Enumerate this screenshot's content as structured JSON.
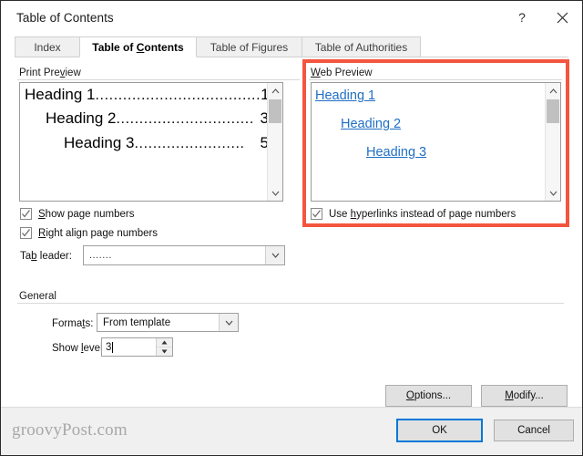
{
  "window": {
    "title": "Table of Contents",
    "help_button": "?",
    "close_button": "×"
  },
  "tabs": [
    {
      "label": "Index",
      "accel": "",
      "selected": false
    },
    {
      "label": "Table of Contents",
      "accel": "C",
      "selected": true
    },
    {
      "label": "Table of Figures",
      "accel": "",
      "selected": false
    },
    {
      "label": "Table of Authorities",
      "accel": "",
      "selected": false
    }
  ],
  "print_preview": {
    "group_label_pre": "Print Pre",
    "group_label_accel": "v",
    "group_label_post": "iew",
    "entries": [
      {
        "text": "Heading 1",
        "leader": "....................................",
        "page": "1",
        "indent": 0
      },
      {
        "text": "Heading 2",
        "leader": "..............................",
        "page": "3",
        "indent": 1
      },
      {
        "text": "Heading 3 ",
        "leader": "........................",
        "page": "5",
        "indent": 2
      }
    ],
    "checkboxes": [
      {
        "pre": "",
        "accel": "S",
        "post": "how page numbers",
        "checked": true
      },
      {
        "pre": "",
        "accel": "R",
        "post": "ight align page numbers",
        "checked": true
      }
    ],
    "tab_leader": {
      "label_pre": "Ta",
      "label_accel": "b",
      "label_post": " leader:",
      "value": ".......",
      "arrow": "⌄"
    }
  },
  "web_preview": {
    "group_label_accel": "W",
    "group_label_post": "eb Preview",
    "entries": [
      {
        "text": "Heading 1",
        "indent": 0
      },
      {
        "text": "Heading 2",
        "indent": 1
      },
      {
        "text": "Heading 3",
        "indent": 2
      }
    ],
    "checkbox": {
      "pre": "Use ",
      "accel": "h",
      "post": "yperlinks instead of page numbers",
      "checked": true
    },
    "link_color": "#1f6fc5",
    "highlight_color": "#f4553f"
  },
  "general": {
    "group_label": "General",
    "formats": {
      "label_pre": "Forma",
      "label_accel": "t",
      "label_post": "s:",
      "value": "From template",
      "arrow": "⌄"
    },
    "show_levels": {
      "label_pre": "Show ",
      "label_accel": "l",
      "label_post": "evels:",
      "value": "3",
      "up_arrow": "▲",
      "down_arrow": "▼"
    }
  },
  "action_buttons": {
    "options": {
      "pre": "",
      "accel": "O",
      "post": "ptions..."
    },
    "modify": {
      "pre": "",
      "accel": "M",
      "post": "odify..."
    }
  },
  "dialog_buttons": {
    "ok": "OK",
    "cancel": "Cancel"
  },
  "watermark": "groovyPost.com",
  "scrollbars": {
    "up_arrow": "ⱏ",
    "down_arrow": "ⱟ"
  }
}
